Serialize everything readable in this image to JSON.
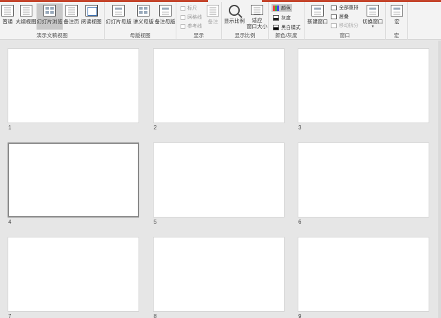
{
  "ribbon": {
    "groups": {
      "presentation_views": "演示文稿视图",
      "master_views": "母版视图",
      "show": "显示",
      "zoom": "显示比例",
      "color_grayscale": "颜色/灰度",
      "window": "窗口",
      "macros": "宏"
    },
    "views": {
      "normal": "普通",
      "outline": "大纲视图",
      "slide_sorter": "幻灯片浏览",
      "notes_page": "备注页",
      "reading_view": "阅读视图"
    },
    "masters": {
      "slide_master": "幻灯片母版",
      "handout_master": "讲义母版",
      "notes_master": "备注母版"
    },
    "show": {
      "ruler": "标尺",
      "gridlines": "网格线",
      "guides": "参考线",
      "notes": "备注"
    },
    "zoom": {
      "zoom": "显示比例",
      "fit_line1": "适应",
      "fit_line2": "窗口大小"
    },
    "color": {
      "color": "颜色",
      "grayscale": "灰度",
      "black_white": "黑白模式"
    },
    "window": {
      "new_window": "新建窗口",
      "arrange_all": "全部重排",
      "cascade": "层叠",
      "move_split": "移动拆分",
      "switch_windows": "切换窗口"
    },
    "macros": {
      "macros": "宏"
    }
  },
  "colors": {
    "accent": "#c4452c",
    "selected_bg": "#c8c8c8",
    "workspace": "#e6e6e6"
  },
  "slides": [
    {
      "number": "1",
      "selected": false
    },
    {
      "number": "2",
      "selected": false
    },
    {
      "number": "3",
      "selected": false
    },
    {
      "number": "4",
      "selected": true
    },
    {
      "number": "5",
      "selected": false
    },
    {
      "number": "6",
      "selected": false
    },
    {
      "number": "7",
      "selected": false
    },
    {
      "number": "8",
      "selected": false
    },
    {
      "number": "9",
      "selected": false
    }
  ]
}
